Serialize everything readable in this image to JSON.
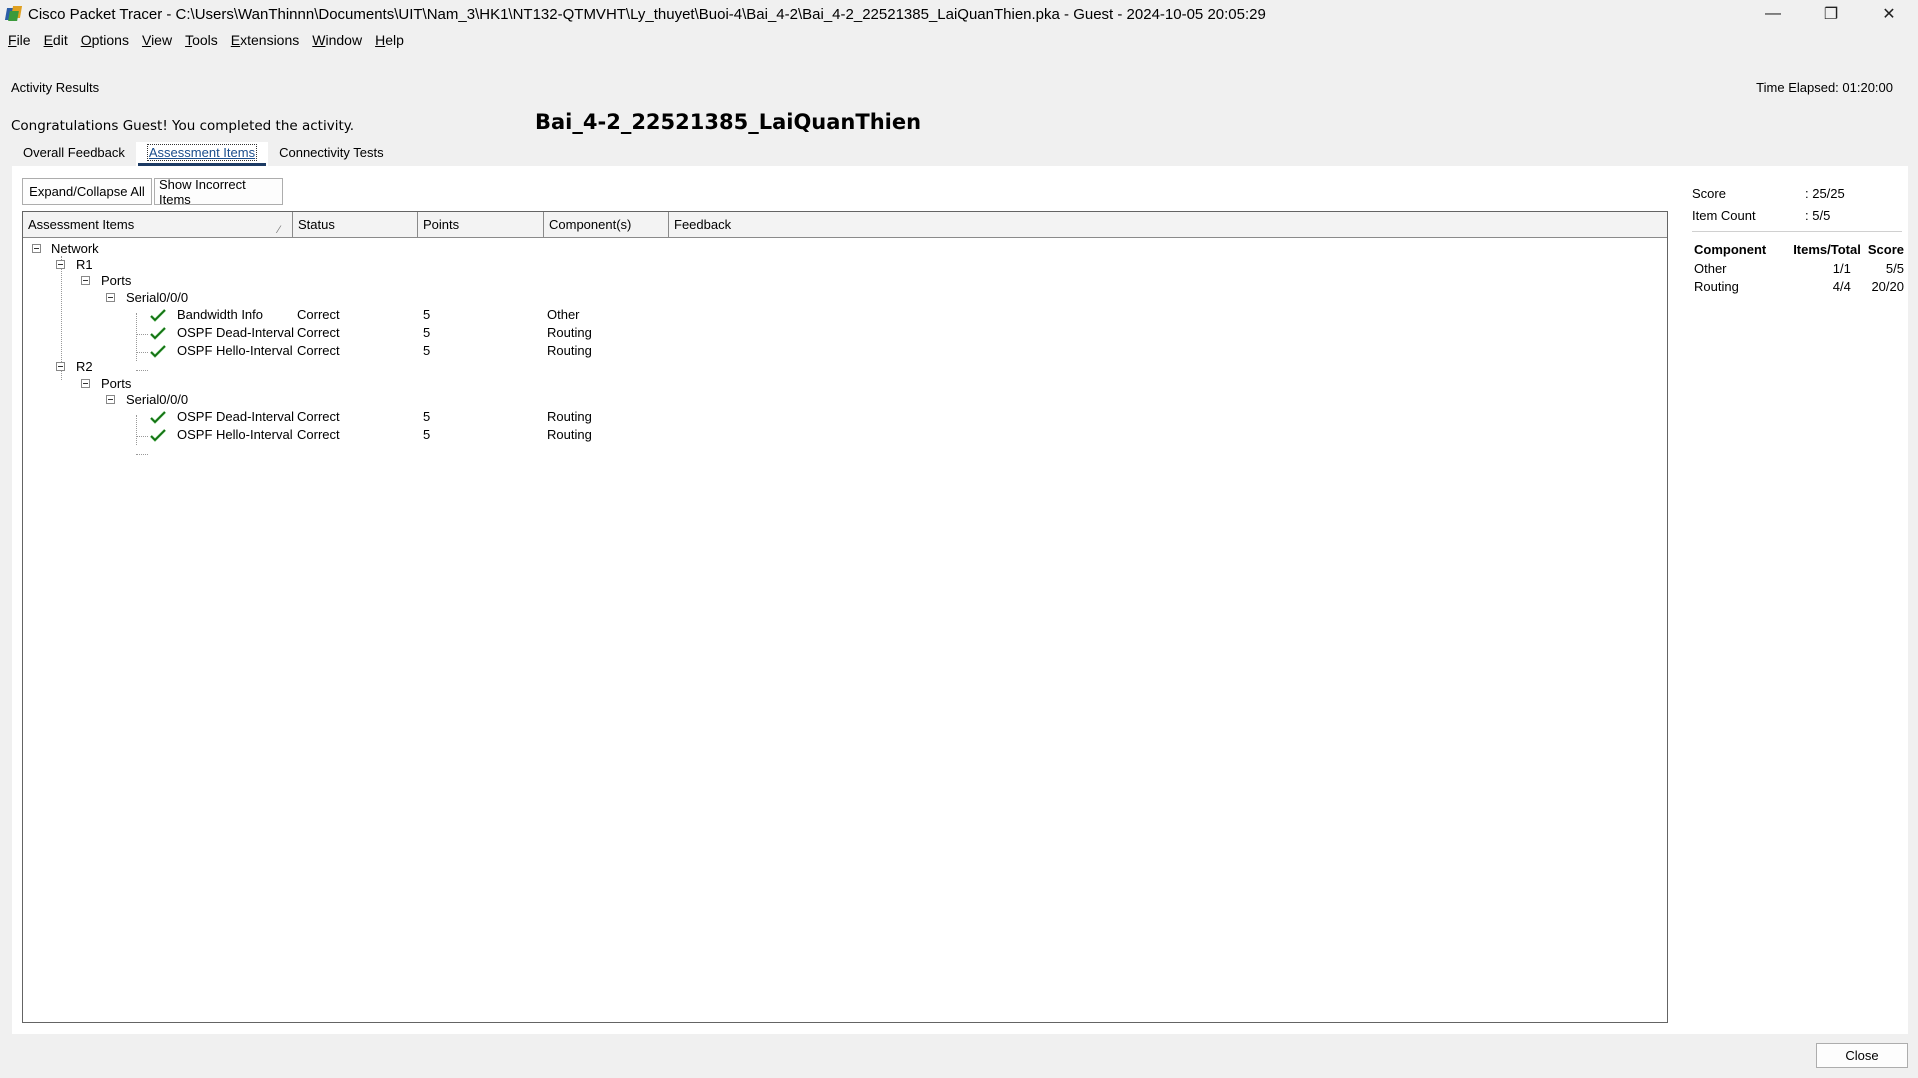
{
  "window": {
    "title": "Cisco Packet Tracer - C:\\Users\\WanThinnn\\Documents\\UIT\\Nam_3\\HK1\\NT132-QTMVHT\\Ly_thuyet\\Buoi-4\\Bai_4-2\\Bai_4-2_22521385_LaiQuanThien.pka - Guest - 2024-10-05 20:05:29",
    "minimize": "—",
    "restore": "❐",
    "close": "✕"
  },
  "menu": [
    {
      "first": "F",
      "rest": "ile"
    },
    {
      "first": "E",
      "rest": "dit"
    },
    {
      "first": "O",
      "rest": "ptions"
    },
    {
      "first": "V",
      "rest": "iew"
    },
    {
      "first": "T",
      "rest": "ools"
    },
    {
      "first": "E",
      "rest": "xtensions"
    },
    {
      "first": "W",
      "rest": "indow"
    },
    {
      "first": "H",
      "rest": "elp"
    }
  ],
  "header": {
    "section": "Activity Results",
    "time_elapsed": "Time Elapsed: 01:20:00",
    "congrats": "Congratulations Guest! You completed the activity.",
    "activity_name": "Bai_4-2_22521385_LaiQuanThien"
  },
  "tabs": [
    {
      "label": "Overall Feedback",
      "active": false
    },
    {
      "label": "Assessment Items",
      "active": true
    },
    {
      "label": "Connectivity Tests",
      "active": false
    }
  ],
  "buttons": {
    "expand_collapse": "Expand/Collapse All",
    "show_incorrect": "Show Incorrect Items",
    "close": "Close"
  },
  "table": {
    "columns": [
      "Assessment Items",
      "Status",
      "Points",
      "Component(s)",
      "Feedback"
    ],
    "tree": {
      "root": "Network",
      "devices": [
        {
          "name": "R1",
          "group": "Ports",
          "port": "Serial0/0/0",
          "items": [
            {
              "name": "Bandwidth Info",
              "status": "Correct",
              "points": "5",
              "component": "Other",
              "feedback": ""
            },
            {
              "name": "OSPF Dead-Interval",
              "status": "Correct",
              "points": "5",
              "component": "Routing",
              "feedback": ""
            },
            {
              "name": "OSPF Hello-Interval",
              "status": "Correct",
              "points": "5",
              "component": "Routing",
              "feedback": ""
            }
          ]
        },
        {
          "name": "R2",
          "group": "Ports",
          "port": "Serial0/0/0",
          "items": [
            {
              "name": "OSPF Dead-Interval",
              "status": "Correct",
              "points": "5",
              "component": "Routing",
              "feedback": ""
            },
            {
              "name": "OSPF Hello-Interval",
              "status": "Correct",
              "points": "5",
              "component": "Routing",
              "feedback": ""
            }
          ]
        }
      ]
    }
  },
  "summary": {
    "score_label": "Score",
    "score_value": ": 25/25",
    "count_label": "Item Count",
    "count_value": ": 5/5",
    "columns": [
      "Component",
      "Items/Total",
      "Score"
    ],
    "rows": [
      {
        "component": "Other",
        "items_total": "1/1",
        "score": "5/5"
      },
      {
        "component": "Routing",
        "items_total": "4/4",
        "score": "20/20"
      }
    ]
  },
  "colors": {
    "check_green": "#2e9a2e",
    "active_tab_underline": "#1b3a63"
  },
  "icons": {
    "check": "check-icon",
    "tree_collapse": "tree-collapse-icon"
  }
}
